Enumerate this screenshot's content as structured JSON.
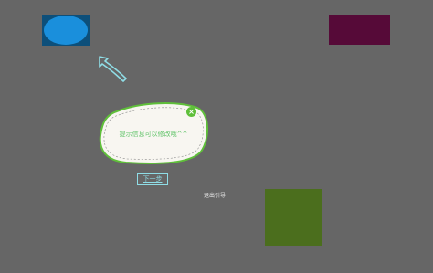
{
  "colors": {
    "background": "#666666",
    "ellipse_box": "#0d4f7a",
    "ellipse": "#1a8fdc",
    "purple_box": "#560a38",
    "green_box": "#4b6e1d",
    "accent_green": "#5fbf3a",
    "accent_cyan": "#8fdde6"
  },
  "tooltip": {
    "text": "提示信息可以修改哦^^",
    "close_icon": "close-icon"
  },
  "guide": {
    "next_label": "下一步",
    "exit_label": "退出引导"
  },
  "arrow": {
    "icon": "pointer-arrow-icon"
  }
}
